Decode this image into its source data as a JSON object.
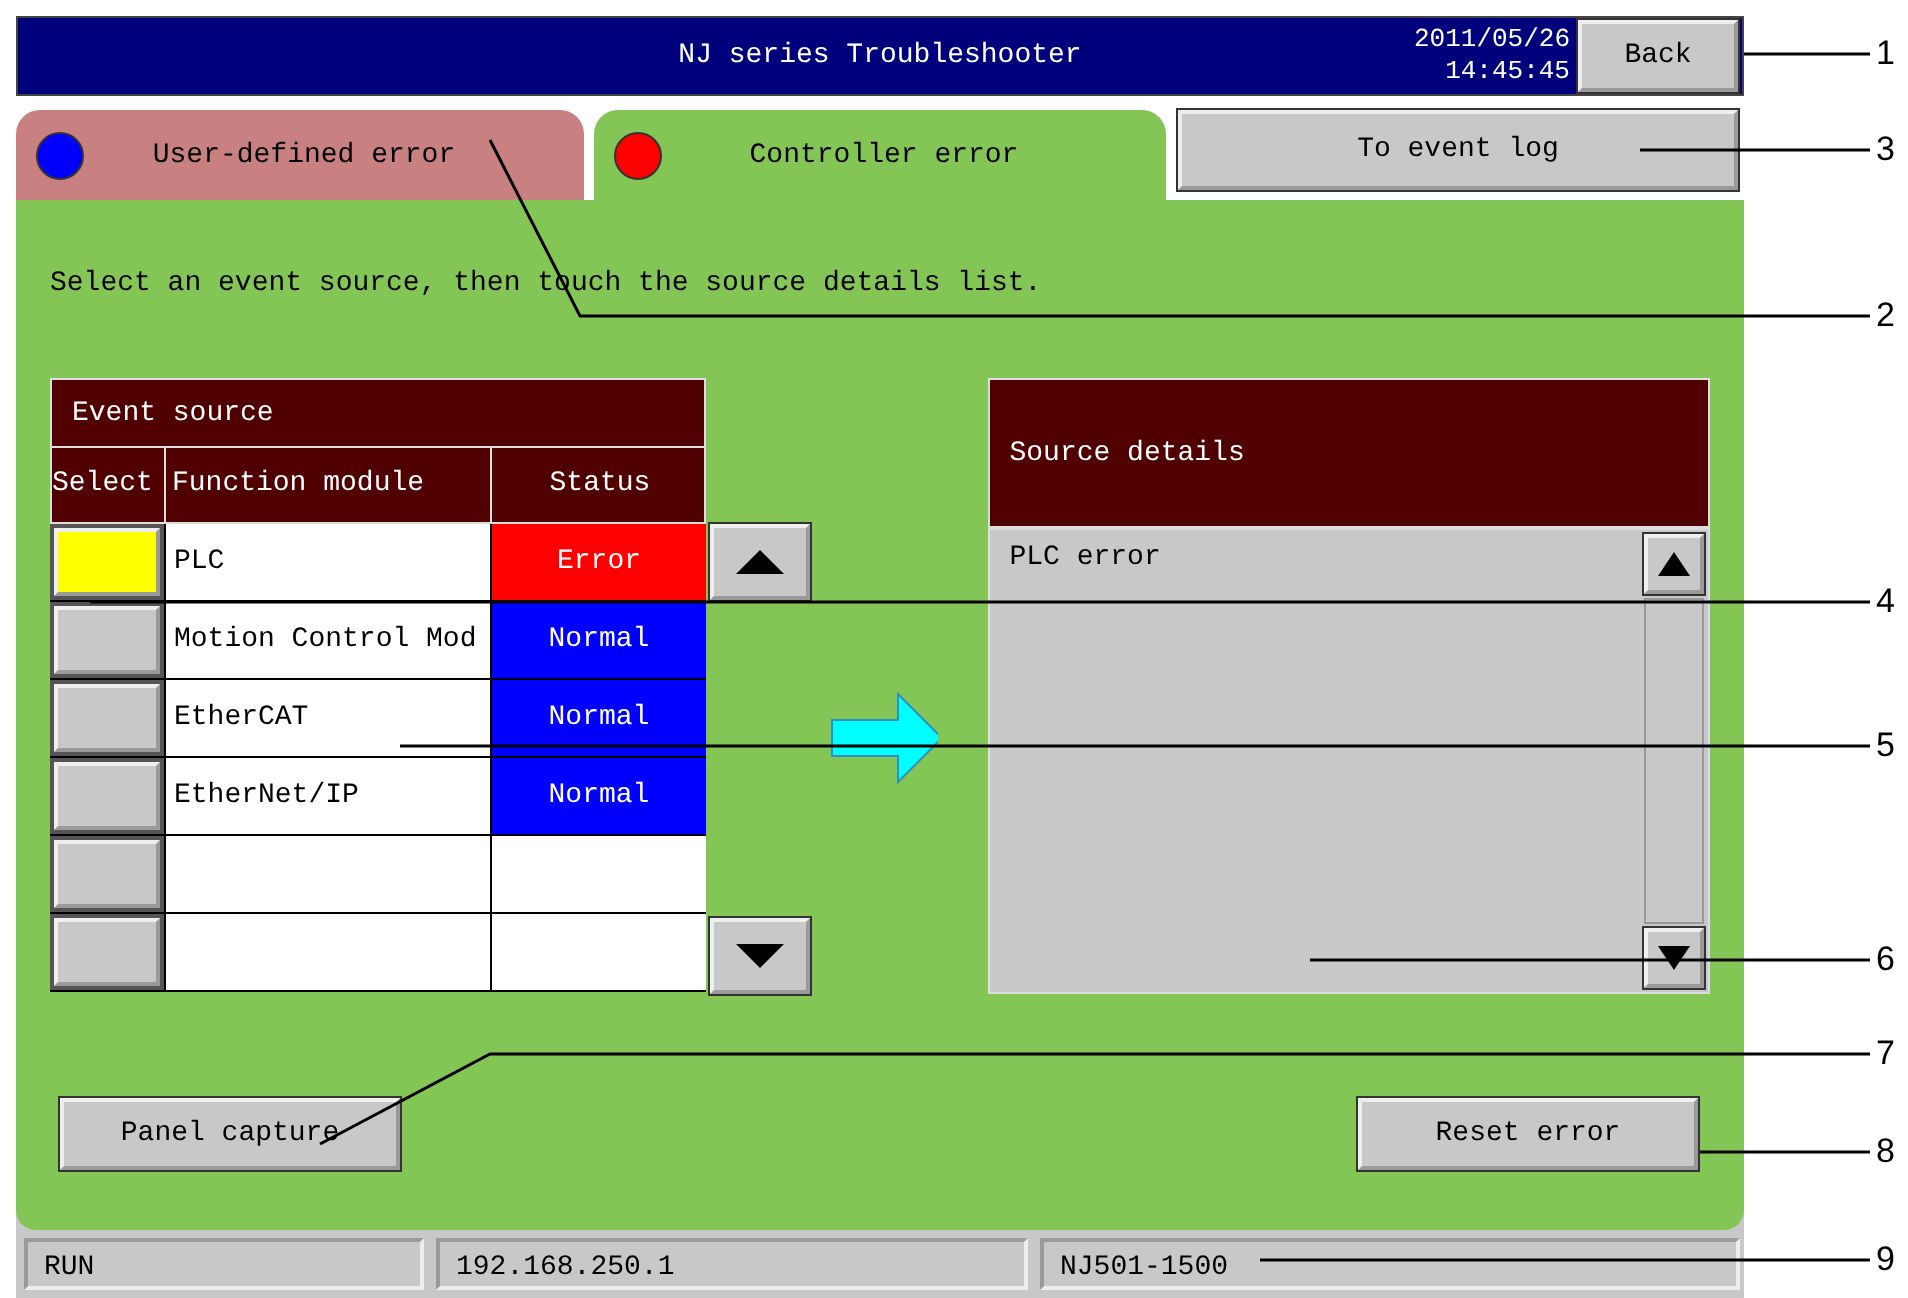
{
  "header": {
    "title": "NJ series Troubleshooter",
    "date": "2011/05/26",
    "time": "14:45:45",
    "back_button": "Back"
  },
  "tabs": [
    {
      "label": "User-defined error",
      "color": "#0000ff",
      "selected": false
    },
    {
      "label": "Controller error",
      "color": "#ff0000",
      "selected": true
    }
  ],
  "event_log_button": "To event log",
  "instruction": "Select an event source, then touch the source details list.",
  "event_source": {
    "title": "Event source",
    "columns": [
      "Select",
      "Function module",
      "Status"
    ],
    "rows": [
      {
        "selected": true,
        "module": "PLC",
        "status": "Error",
        "kind": "error"
      },
      {
        "selected": false,
        "module": "Motion Control Mod",
        "status": "Normal",
        "kind": "normal"
      },
      {
        "selected": false,
        "module": "EtherCAT",
        "status": "Normal",
        "kind": "normal"
      },
      {
        "selected": false,
        "module": "EtherNet/IP",
        "status": "Normal",
        "kind": "normal"
      },
      {
        "selected": false,
        "module": "",
        "status": "",
        "kind": "empty"
      },
      {
        "selected": false,
        "module": "",
        "status": "",
        "kind": "empty"
      }
    ]
  },
  "source_details": {
    "title": "Source details",
    "items": [
      "PLC error"
    ]
  },
  "buttons": {
    "panel_capture": "Panel capture",
    "reset_error": "Reset error"
  },
  "status_bar": [
    "RUN",
    "192.168.250.1",
    "NJ501-1500"
  ],
  "callouts": [
    "1",
    "3",
    "2",
    "4",
    "5",
    "6",
    "7",
    "8",
    "9"
  ]
}
